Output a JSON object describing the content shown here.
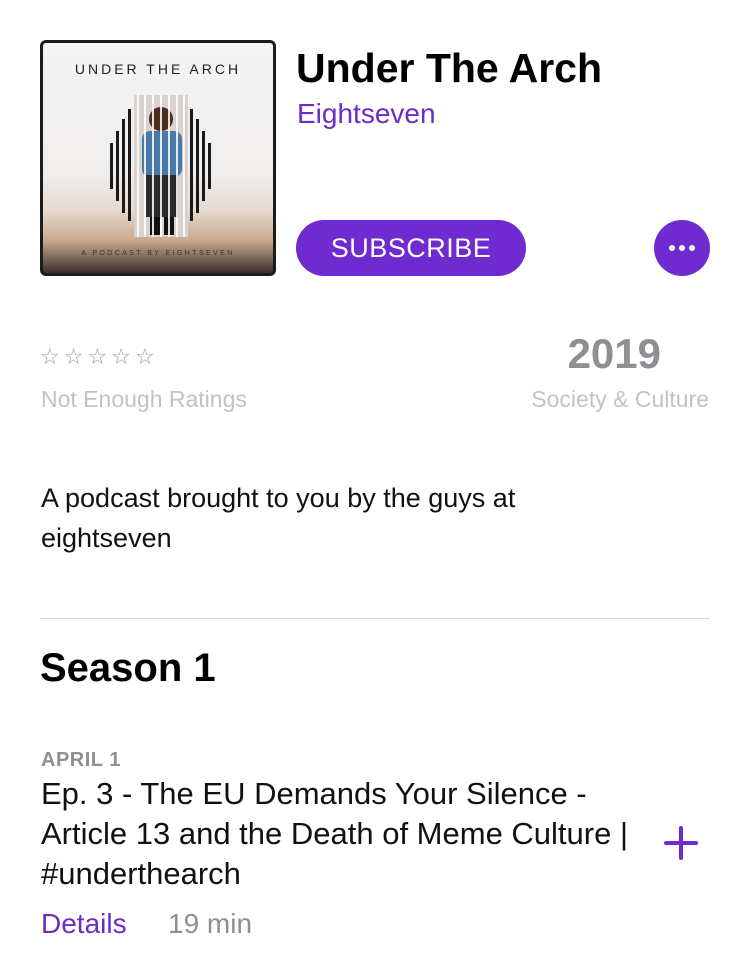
{
  "podcast": {
    "artwork": {
      "title": "UNDER THE ARCH",
      "subtitle": "A PODCAST BY EIGHTSEVEN"
    },
    "title": "Under The Arch",
    "author": "Eightseven",
    "subscribe_label": "SUBSCRIBE",
    "more_icon": "ellipsis-icon",
    "rating": {
      "stars_filled": 0,
      "stars_total": 5,
      "star_glyph": "☆",
      "label": "Not Enough Ratings"
    },
    "year": "2019",
    "genre": "Society & Culture",
    "description": "A podcast brought to you by the guys at eightseven"
  },
  "season": {
    "title": "Season 1"
  },
  "episodes": [
    {
      "date": "APRIL 1",
      "title": "Ep. 3 - The EU Demands Your Silence - Article 13 and the Death of Meme Culture | #underthearch",
      "details_label": "Details",
      "duration": "19 min",
      "add_icon": "plus-icon"
    }
  ],
  "colors": {
    "accent": "#6f2ad0",
    "secondary_text": "#8e8e93",
    "muted_text": "#c2c2c2"
  }
}
